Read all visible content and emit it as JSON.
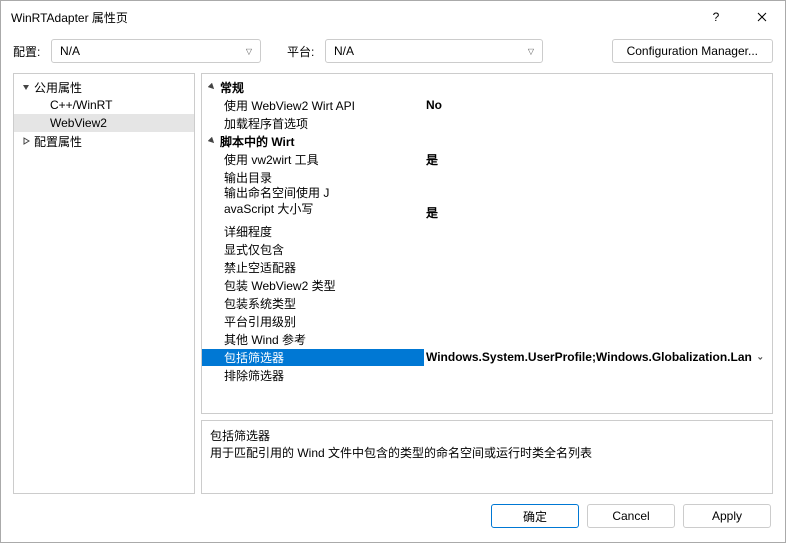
{
  "titlebar": {
    "title": "WinRTAdapter 属性页"
  },
  "toolbar": {
    "config_label": "配置:",
    "config_value": "N/A",
    "platform_label": "平台:",
    "platform_value": "N/A",
    "config_manager": "Configuration Manager..."
  },
  "tree": {
    "root1": "公用属性",
    "child1": "C++/WinRT",
    "child2": "WebView2",
    "root2": "配置属性"
  },
  "groups": {
    "g1": "常规",
    "g2": "脚本中的 Wirt"
  },
  "props": {
    "p1_name": "使用 WebView2 Wirt API",
    "p1_val": "No",
    "p2_name": "加载程序首选项",
    "p2_val": "",
    "p3_name": "使用 vw2wirt 工具",
    "p3_val": "是",
    "p4_name": "输出目录",
    "p4_val": "",
    "p5_name": "输出命名空间使用 JavaScript 大小写",
    "p5_val": "是",
    "p6_name": "详细程度",
    "p6_val": "",
    "p7_name": "显式仅包含",
    "p7_val": "",
    "p8_name": "禁止空适配器",
    "p8_val": "",
    "p9_name": "包装 WebView2 类型",
    "p9_val": "",
    "p10_name": "包装系统类型",
    "p10_val": "",
    "p11_name": "平台引用级别",
    "p11_val": "",
    "p12_name": "其他 Wind 参考",
    "p12_val": "",
    "p13_name": "包括筛选器",
    "p13_val": "Windows.System.UserProfile;Windows.Globalization.Lan",
    "p14_name": "排除筛选器",
    "p14_val": ""
  },
  "desc": {
    "title": "包括筛选器",
    "body": "用于匹配引用的 Wind 文件中包含的类型的命名空间或运行时类全名列表"
  },
  "footer": {
    "ok": "确定",
    "cancel": "Cancel",
    "apply": "Apply"
  }
}
